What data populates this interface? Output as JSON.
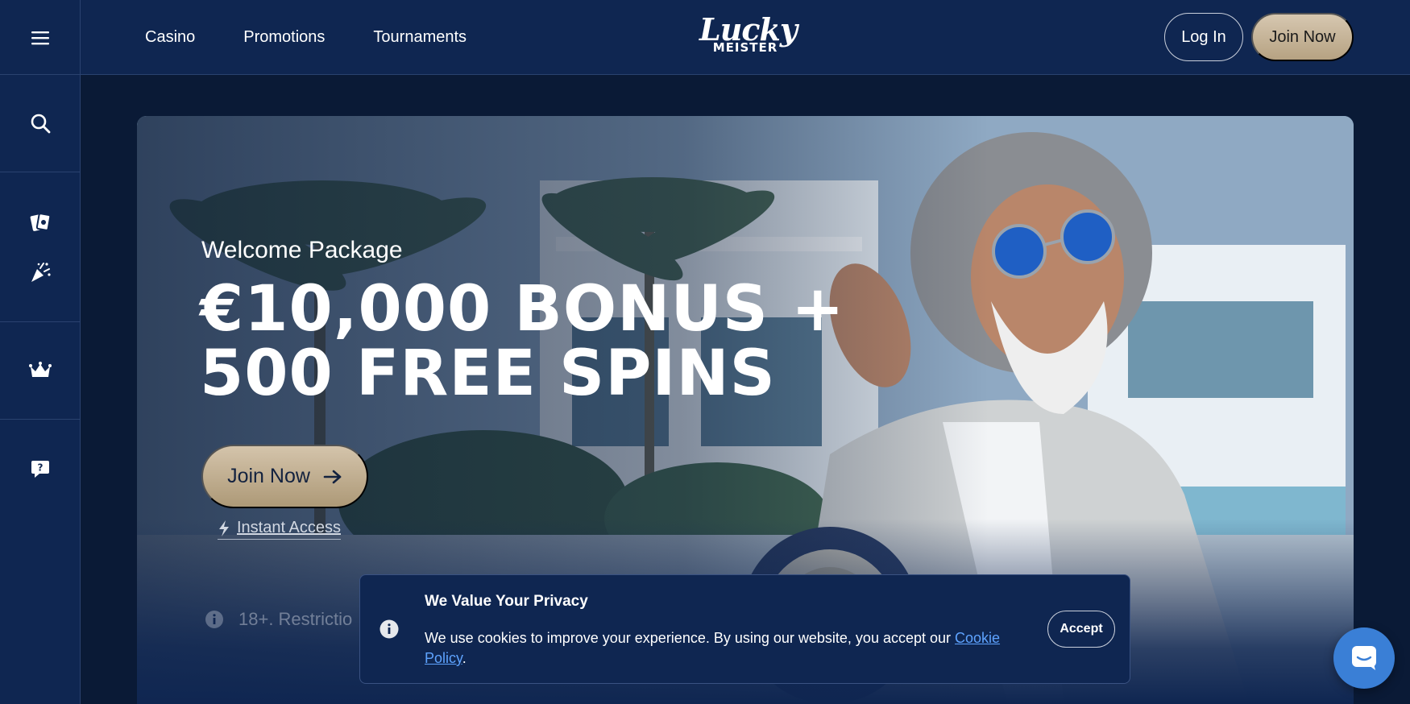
{
  "header": {
    "menu_icon": "hamburger-menu-icon",
    "nav": [
      {
        "label": "Casino"
      },
      {
        "label": "Promotions"
      },
      {
        "label": "Tournaments"
      }
    ],
    "logo_line1": "Lucky",
    "logo_line2": "MEISTER",
    "login_label": "Log In",
    "join_label": "Join Now"
  },
  "sidebar": {
    "icons": [
      "search-icon",
      "cards-icon",
      "confetti-icon",
      "crown-icon",
      "help-chat-icon"
    ]
  },
  "hero": {
    "welcome": "Welcome Package",
    "headline_line1": "€10,000 BONUS +",
    "headline_line2": "500 FREE SPINS",
    "join_label": "Join Now",
    "instant_access": "Instant Access",
    "restriction": "18+. Restrictio"
  },
  "cookie": {
    "title": "We Value Your Privacy",
    "text_before": "We use cookies to improve your experience. By using our website, you accept our ",
    "link_label": "Cookie Policy",
    "text_after": ".",
    "accept_label": "Accept"
  },
  "colors": {
    "background": "#0a1a36",
    "panel": "#0f2651",
    "gold_button": "#c5b498",
    "link": "#5ea3ff",
    "chat": "#3a7fd6"
  }
}
